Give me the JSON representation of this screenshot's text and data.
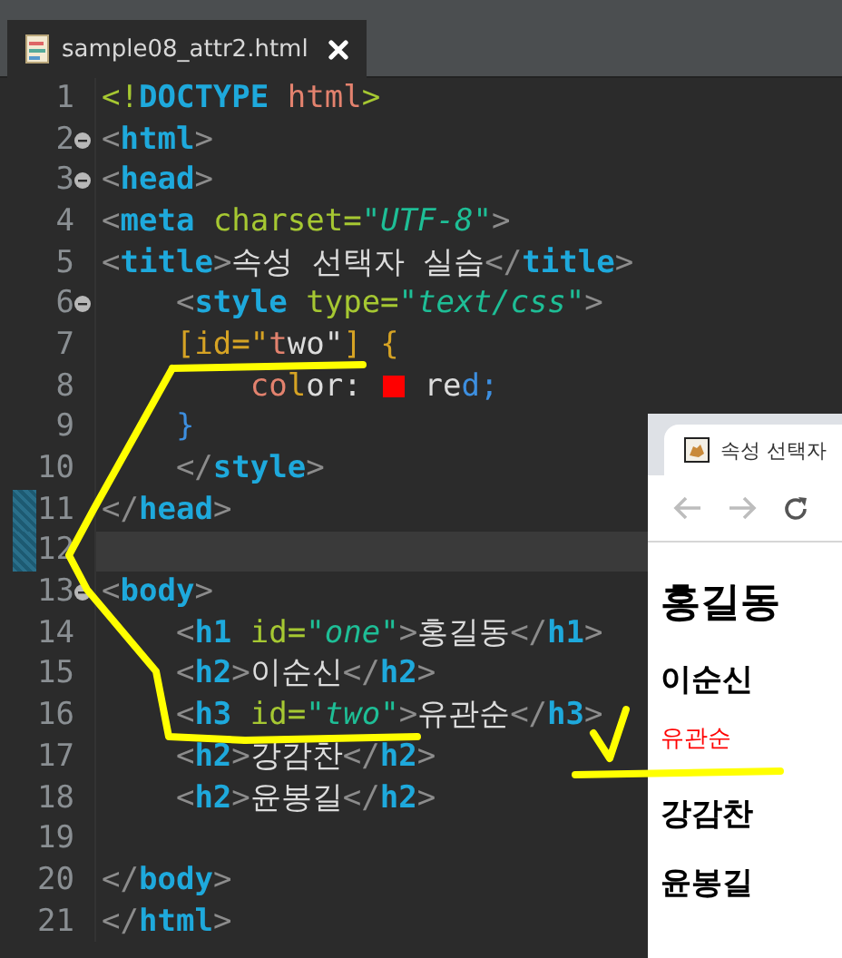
{
  "editor_tab": {
    "filename": "sample08_attr2.html",
    "selected": true
  },
  "lines": [
    {
      "number": "1",
      "fold": false,
      "marked": false,
      "current": false,
      "tokens": [
        {
          "kind": "decl",
          "text": "<!"
        },
        {
          "kind": "tag",
          "text": "DOCTYPE"
        },
        {
          "kind": "kw",
          "text": " html"
        },
        {
          "kind": "decl",
          "text": ">"
        }
      ]
    },
    {
      "number": "2",
      "fold": true,
      "marked": false,
      "current": false,
      "tokens": [
        {
          "kind": "p",
          "text": "<"
        },
        {
          "kind": "tag",
          "text": "html"
        },
        {
          "kind": "p",
          "text": ">"
        }
      ]
    },
    {
      "number": "3",
      "fold": true,
      "marked": false,
      "current": false,
      "tokens": [
        {
          "kind": "p",
          "text": "<"
        },
        {
          "kind": "tag",
          "text": "head"
        },
        {
          "kind": "p",
          "text": ">"
        }
      ]
    },
    {
      "number": "4",
      "fold": false,
      "marked": false,
      "current": false,
      "tokens": [
        {
          "kind": "p",
          "text": "<"
        },
        {
          "kind": "tag",
          "text": "meta"
        },
        {
          "kind": "attr",
          "text": " charset="
        },
        {
          "kind": "val",
          "text": "\"UTF-8\""
        },
        {
          "kind": "p",
          "text": ">"
        }
      ]
    },
    {
      "number": "5",
      "fold": false,
      "marked": false,
      "current": false,
      "tokens": [
        {
          "kind": "p",
          "text": "<"
        },
        {
          "kind": "tag",
          "text": "title"
        },
        {
          "kind": "p",
          "text": ">"
        },
        {
          "kind": "txt",
          "text": "속성 선택자 실습"
        },
        {
          "kind": "p",
          "text": "</"
        },
        {
          "kind": "tag",
          "text": "title"
        },
        {
          "kind": "p",
          "text": ">"
        }
      ]
    },
    {
      "number": "6",
      "fold": true,
      "marked": false,
      "current": false,
      "tokens": [
        {
          "kind": "p",
          "text": "    <"
        },
        {
          "kind": "tag",
          "text": "style"
        },
        {
          "kind": "attr",
          "text": " type="
        },
        {
          "kind": "val",
          "text": "\"text/css\""
        },
        {
          "kind": "p",
          "text": ">"
        }
      ]
    },
    {
      "number": "7",
      "fold": false,
      "marked": false,
      "current": false,
      "tokens": [
        {
          "kind": "sel",
          "text": "    [id=\""
        },
        {
          "kind": "kw",
          "text": "t"
        },
        {
          "kind": "txt",
          "text": "wo\""
        },
        {
          "kind": "sel",
          "text": "] {"
        }
      ]
    },
    {
      "number": "8",
      "fold": false,
      "marked": false,
      "current": false,
      "tokens": [
        {
          "kind": "kw",
          "text": "        co"
        },
        {
          "kind": "sel",
          "text": "l"
        },
        {
          "kind": "txt",
          "text": "or: "
        },
        {
          "kind": "swatch",
          "color": "#ff0000"
        },
        {
          "kind": "txt",
          "text": " re"
        },
        {
          "kind": "br",
          "text": "d;"
        }
      ]
    },
    {
      "number": "9",
      "fold": false,
      "marked": false,
      "current": false,
      "tokens": [
        {
          "kind": "br",
          "text": "    }"
        }
      ]
    },
    {
      "number": "10",
      "fold": false,
      "marked": false,
      "current": false,
      "tokens": [
        {
          "kind": "p",
          "text": "    </"
        },
        {
          "kind": "tag",
          "text": "style"
        },
        {
          "kind": "p",
          "text": ">"
        }
      ]
    },
    {
      "number": "11",
      "fold": false,
      "marked": true,
      "current": false,
      "tokens": [
        {
          "kind": "p",
          "text": "</"
        },
        {
          "kind": "tag",
          "text": "head"
        },
        {
          "kind": "p",
          "text": ">"
        }
      ]
    },
    {
      "number": "12",
      "fold": false,
      "marked": true,
      "current": true
    },
    {
      "number": "13",
      "fold": true,
      "marked": false,
      "current": false,
      "tokens": [
        {
          "kind": "p",
          "text": "<"
        },
        {
          "kind": "tag",
          "text": "body"
        },
        {
          "kind": "p",
          "text": ">"
        }
      ]
    },
    {
      "number": "14",
      "fold": false,
      "marked": false,
      "current": false,
      "tokens": [
        {
          "kind": "p",
          "text": "    <"
        },
        {
          "kind": "tag",
          "text": "h1"
        },
        {
          "kind": "attr",
          "text": " id="
        },
        {
          "kind": "val",
          "text": "\"one\""
        },
        {
          "kind": "p",
          "text": ">"
        },
        {
          "kind": "txt",
          "text": "홍길동"
        },
        {
          "kind": "p",
          "text": "</"
        },
        {
          "kind": "tag",
          "text": "h1"
        },
        {
          "kind": "p",
          "text": ">"
        }
      ]
    },
    {
      "number": "15",
      "fold": false,
      "marked": false,
      "current": false,
      "tokens": [
        {
          "kind": "p",
          "text": "    <"
        },
        {
          "kind": "tag",
          "text": "h2"
        },
        {
          "kind": "p",
          "text": ">"
        },
        {
          "kind": "txt",
          "text": "이순신"
        },
        {
          "kind": "p",
          "text": "</"
        },
        {
          "kind": "tag",
          "text": "h2"
        },
        {
          "kind": "p",
          "text": ">"
        }
      ]
    },
    {
      "number": "16",
      "fold": false,
      "marked": false,
      "current": false,
      "tokens": [
        {
          "kind": "p",
          "text": "    <"
        },
        {
          "kind": "tag",
          "text": "h3"
        },
        {
          "kind": "attr",
          "text": " id="
        },
        {
          "kind": "val",
          "text": "\"two\""
        },
        {
          "kind": "p",
          "text": ">"
        },
        {
          "kind": "txt",
          "text": "유관순"
        },
        {
          "kind": "p",
          "text": "</"
        },
        {
          "kind": "tag",
          "text": "h3"
        },
        {
          "kind": "p",
          "text": ">"
        }
      ]
    },
    {
      "number": "17",
      "fold": false,
      "marked": false,
      "current": false,
      "tokens": [
        {
          "kind": "p",
          "text": "    <"
        },
        {
          "kind": "tag",
          "text": "h2"
        },
        {
          "kind": "p",
          "text": ">"
        },
        {
          "kind": "txt",
          "text": "강감찬"
        },
        {
          "kind": "p",
          "text": "</"
        },
        {
          "kind": "tag",
          "text": "h2"
        },
        {
          "kind": "p",
          "text": ">"
        }
      ]
    },
    {
      "number": "18",
      "fold": false,
      "marked": false,
      "current": false,
      "tokens": [
        {
          "kind": "p",
          "text": "    <"
        },
        {
          "kind": "tag",
          "text": "h2"
        },
        {
          "kind": "p",
          "text": ">"
        },
        {
          "kind": "txt",
          "text": "윤봉길"
        },
        {
          "kind": "p",
          "text": "</"
        },
        {
          "kind": "tag",
          "text": "h2"
        },
        {
          "kind": "p",
          "text": ">"
        }
      ]
    },
    {
      "number": "19",
      "fold": false,
      "marked": false,
      "current": false
    },
    {
      "number": "20",
      "fold": false,
      "marked": false,
      "current": false,
      "tokens": [
        {
          "kind": "p",
          "text": "</"
        },
        {
          "kind": "tag",
          "text": "body"
        },
        {
          "kind": "p",
          "text": ">"
        }
      ]
    },
    {
      "number": "21",
      "fold": false,
      "marked": false,
      "current": false,
      "tokens": [
        {
          "kind": "p",
          "text": "</"
        },
        {
          "kind": "tag",
          "text": "html"
        },
        {
          "kind": "p",
          "text": ">"
        }
      ]
    }
  ],
  "browser": {
    "tab_title": "속성 선택자",
    "headings": [
      {
        "kind": "h1",
        "text": "홍길동"
      },
      {
        "kind": "h2",
        "text": "이순신"
      },
      {
        "kind": "h3",
        "text": "유관순"
      },
      {
        "kind": "h2",
        "text": "강감찬"
      },
      {
        "kind": "h2",
        "text": "윤봉길"
      }
    ]
  }
}
